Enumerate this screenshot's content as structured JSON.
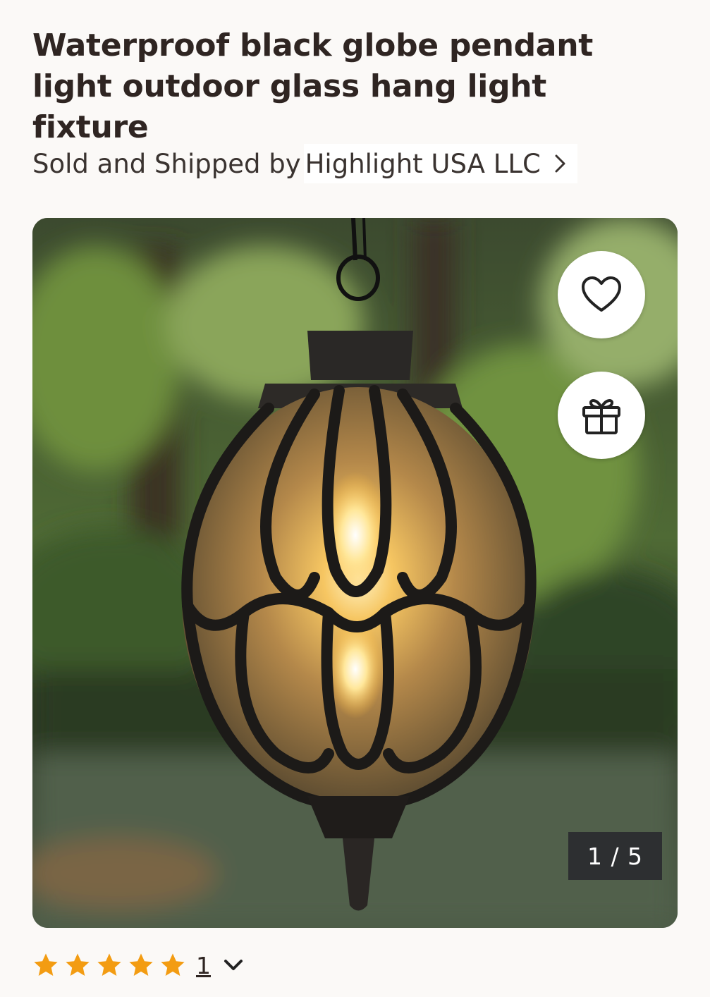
{
  "product": {
    "title": "Waterproof black globe pendant light outdoor glass hang light fixture",
    "seller_prefix": "Sold and Shipped by",
    "seller_name": "Highlight USA LLC"
  },
  "gallery": {
    "counter": "1 / 5",
    "current_image": 1,
    "total_images": 5,
    "wishlist_icon": "heart-icon",
    "gift_icon": "gift-icon"
  },
  "rating": {
    "stars": 5,
    "review_count": "1",
    "star_color": "#f39c12"
  },
  "colors": {
    "accent_star": "#f39c12",
    "title_text": "#2f2522",
    "background": "#fbf9f7"
  }
}
